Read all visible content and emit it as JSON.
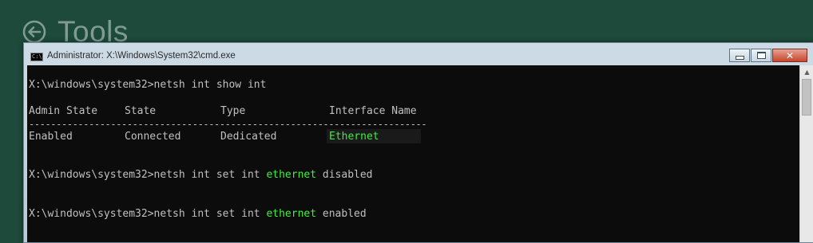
{
  "background": {
    "title": "Tools",
    "color": "#1d4a3a",
    "back_icon": "back-arrow-circle-icon"
  },
  "window": {
    "title": "Administrator: X:\\Windows\\System32\\cmd.exe",
    "icon": "command-prompt-icon",
    "controls": {
      "minimize": "minimize-icon",
      "maximize": "maximize-icon",
      "close": "close-icon"
    }
  },
  "console": {
    "prompt": "X:\\windows\\system32>",
    "cmd1": "netsh int show int",
    "table": {
      "headers": [
        "Admin State",
        "State",
        "Type",
        "Interface Name"
      ],
      "separator": "-------------------------------------------------------------------------",
      "rows": [
        [
          "Enabled",
          "Connected",
          "Dedicated",
          "Ethernet"
        ]
      ]
    },
    "cmd2": {
      "before": "netsh int set int ",
      "highlight": "ethernet",
      "after": " disabled"
    },
    "cmd3": {
      "before": "netsh int set int ",
      "highlight": "ethernet",
      "after": " enabled"
    },
    "text_color": "#c0c0c0",
    "highlight_color": "#3ef03e"
  }
}
